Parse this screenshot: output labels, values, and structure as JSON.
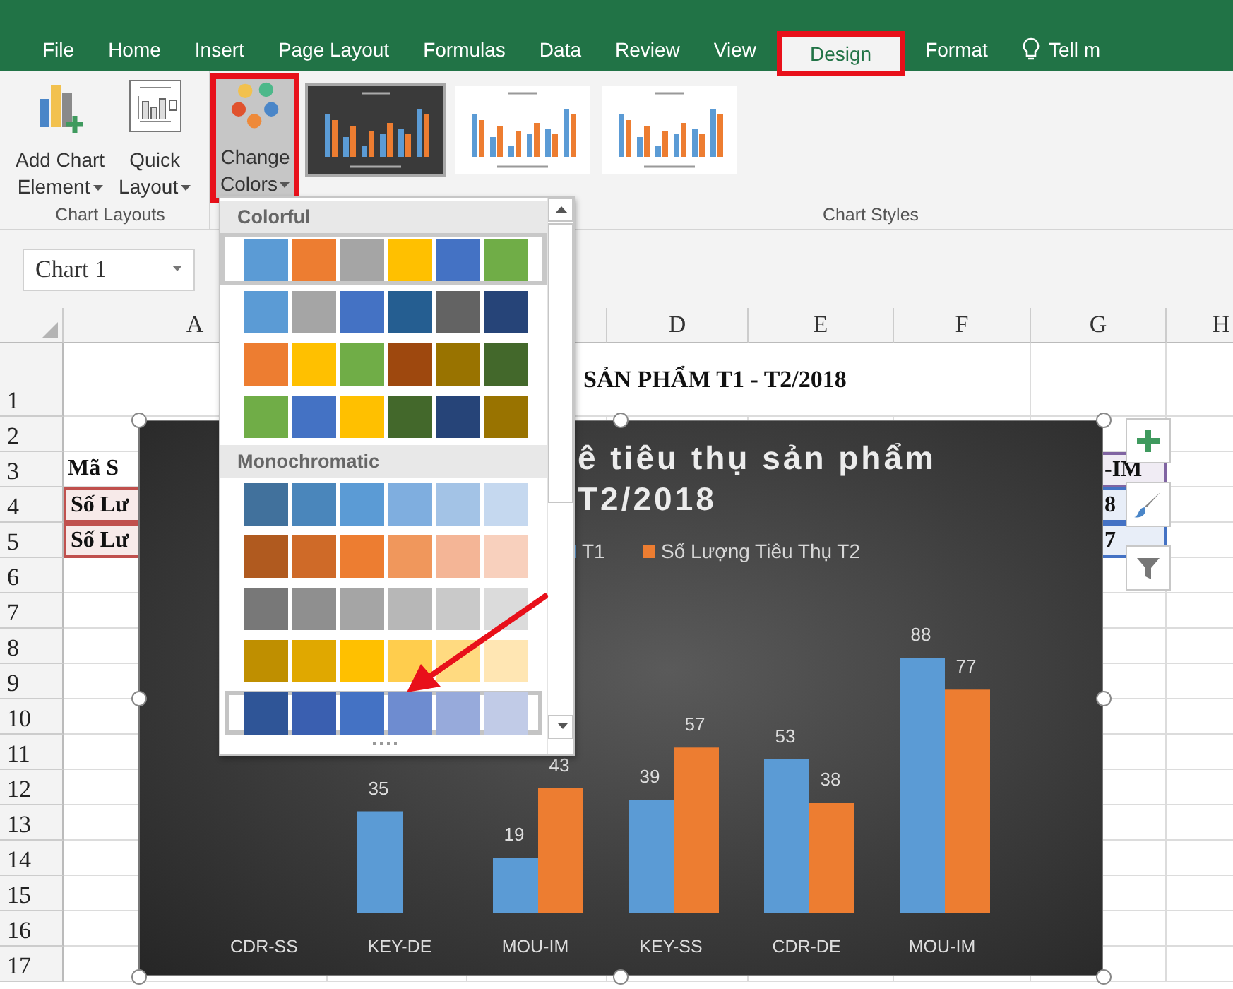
{
  "tabs": [
    {
      "label": "File",
      "selected": false,
      "highlighted": false
    },
    {
      "label": "Home",
      "selected": false,
      "highlighted": false
    },
    {
      "label": "Insert",
      "selected": false,
      "highlighted": false
    },
    {
      "label": "Page Layout",
      "selected": false,
      "highlighted": false
    },
    {
      "label": "Formulas",
      "selected": false,
      "highlighted": false
    },
    {
      "label": "Data",
      "selected": false,
      "highlighted": false
    },
    {
      "label": "Review",
      "selected": false,
      "highlighted": false
    },
    {
      "label": "View",
      "selected": false,
      "highlighted": false
    },
    {
      "label": "Design",
      "selected": true,
      "highlighted": true
    },
    {
      "label": "Format",
      "selected": false,
      "highlighted": false
    }
  ],
  "tell_me": "Tell m",
  "ribbon": {
    "groups": [
      {
        "label": "Chart Layouts",
        "buttons": [
          {
            "kind": "add-chart",
            "lines": [
              "Add Chart",
              "Element"
            ],
            "dropdown": true,
            "pressed": false,
            "highlighted": false
          },
          {
            "kind": "quick-layout",
            "lines": [
              "Quick",
              "Layout"
            ],
            "dropdown": true,
            "pressed": false,
            "highlighted": false
          }
        ]
      },
      {
        "label": "Chart Styles",
        "buttons": [
          {
            "kind": "change-colors",
            "lines": [
              "Change",
              "Colors"
            ],
            "dropdown": true,
            "pressed": true,
            "highlighted": true
          }
        ],
        "styles": [
          {
            "kind": "dark",
            "selected": true
          },
          {
            "kind": "light",
            "selected": false
          },
          {
            "kind": "light",
            "selected": false
          }
        ]
      }
    ]
  },
  "name_box": "Chart 1",
  "columns": [
    {
      "label": "A"
    },
    {},
    {},
    {
      "label": "D"
    },
    {
      "label": "E"
    },
    {
      "label": "F"
    },
    {
      "label": "G"
    },
    {
      "label": "H"
    }
  ],
  "rows": [
    {
      "number": "1",
      "cells": [
        null,
        null,
        {
          "kind": "title",
          "text": "SẢN PHẨM T1 - T2/2018"
        }
      ]
    },
    {
      "number": "2"
    },
    {
      "number": "3",
      "cells": [
        {
          "kind": "label",
          "text": "Mã S"
        },
        null,
        null,
        null,
        null,
        null,
        {
          "kind": "edge",
          "text": "-IM",
          "color": "#8064a2"
        }
      ]
    },
    {
      "number": "4",
      "cells": [
        {
          "kind": "label",
          "text": "Số Lư",
          "color": "#c0504d"
        },
        null,
        null,
        null,
        null,
        null,
        {
          "kind": "edge",
          "text": "8",
          "color": "#4472c4"
        }
      ]
    },
    {
      "number": "5",
      "cells": [
        {
          "kind": "label",
          "text": "Số Lư",
          "color": "#c0504d"
        },
        null,
        null,
        null,
        null,
        null,
        {
          "kind": "edge",
          "text": "7",
          "color": "#4472c4"
        }
      ]
    },
    {
      "number": "6"
    },
    {
      "number": "7"
    },
    {
      "number": "8"
    },
    {
      "number": "9"
    },
    {
      "number": "10"
    },
    {
      "number": "11"
    },
    {
      "number": "12"
    },
    {
      "number": "13"
    },
    {
      "number": "14"
    },
    {
      "number": "15"
    },
    {
      "number": "16"
    },
    {
      "number": "17"
    }
  ],
  "chart": {
    "title_lines": [
      "ê tiêu thụ sản phẩm",
      "T2/2018"
    ],
    "chart_data": {
      "type": "bar",
      "legend": "top",
      "categories": [
        "CDR-SS",
        "KEY-DE",
        "MOU-IM",
        "KEY-SS",
        "CDR-DE",
        "MOU-IM"
      ],
      "data_labels": true,
      "series": [
        {
          "name": "T1",
          "color": "#5b9bd5",
          "values": [
            null,
            35,
            19,
            39,
            53,
            88
          ]
        },
        {
          "name": "Số Lượng Tiêu Thụ T2",
          "color": "#ed7d31",
          "values": [
            null,
            null,
            43,
            57,
            38,
            77
          ]
        }
      ]
    }
  },
  "color_menu": {
    "sections": [
      {
        "title": "Colorful",
        "options": [
          {
            "selected": true,
            "hovered": false,
            "swatches": [
              {
                "color": "#5b9bd5"
              },
              {
                "color": "#ed7d31"
              },
              {
                "color": "#a5a5a5"
              },
              {
                "color": "#ffc000"
              },
              {
                "color": "#4472c4"
              },
              {
                "color": "#70ad47"
              }
            ]
          },
          {
            "selected": false,
            "hovered": false,
            "swatches": [
              {
                "color": "#5b9bd5"
              },
              {
                "color": "#a5a5a5"
              },
              {
                "color": "#4472c4"
              },
              {
                "color": "#255e91"
              },
              {
                "color": "#636363"
              },
              {
                "color": "#264478"
              }
            ]
          },
          {
            "selected": false,
            "hovered": false,
            "swatches": [
              {
                "color": "#ed7d31"
              },
              {
                "color": "#ffc000"
              },
              {
                "color": "#70ad47"
              },
              {
                "color": "#9e480e"
              },
              {
                "color": "#997300"
              },
              {
                "color": "#43682b"
              }
            ]
          },
          {
            "selected": false,
            "hovered": false,
            "swatches": [
              {
                "color": "#70ad47"
              },
              {
                "color": "#4472c4"
              },
              {
                "color": "#ffc000"
              },
              {
                "color": "#43682b"
              },
              {
                "color": "#264478"
              },
              {
                "color": "#997300"
              }
            ]
          }
        ]
      },
      {
        "title": "Monochromatic",
        "options": [
          {
            "selected": false,
            "hovered": false,
            "swatches": [
              {
                "color": "#41719c"
              },
              {
                "color": "#4a86bb"
              },
              {
                "color": "#5b9bd5"
              },
              {
                "color": "#7faedf"
              },
              {
                "color": "#a3c3e6"
              },
              {
                "color": "#c5d8ef"
              }
            ]
          },
          {
            "selected": false,
            "hovered": false,
            "swatches": [
              {
                "color": "#b05a1f"
              },
              {
                "color": "#cf6a28"
              },
              {
                "color": "#ed7d31"
              },
              {
                "color": "#f0975c"
              },
              {
                "color": "#f4b596"
              },
              {
                "color": "#f8d0bd"
              }
            ]
          },
          {
            "selected": false,
            "hovered": false,
            "swatches": [
              {
                "color": "#787878"
              },
              {
                "color": "#8f8f8f"
              },
              {
                "color": "#a5a5a5"
              },
              {
                "color": "#b7b7b7"
              },
              {
                "color": "#c9c9c9"
              },
              {
                "color": "#dbdbdb"
              }
            ]
          },
          {
            "selected": false,
            "hovered": false,
            "swatches": [
              {
                "color": "#bf8f00"
              },
              {
                "color": "#e0a800"
              },
              {
                "color": "#ffc000"
              },
              {
                "color": "#ffcd4d"
              },
              {
                "color": "#ffda80"
              },
              {
                "color": "#ffe6b3"
              }
            ]
          },
          {
            "selected": false,
            "hovered": true,
            "swatches": [
              {
                "color": "#2f5597"
              },
              {
                "color": "#3a5fb0"
              },
              {
                "color": "#4472c4"
              },
              {
                "color": "#6e8cd0"
              },
              {
                "color": "#97aadb"
              },
              {
                "color": "#c1cbe7"
              }
            ]
          }
        ]
      }
    ]
  }
}
